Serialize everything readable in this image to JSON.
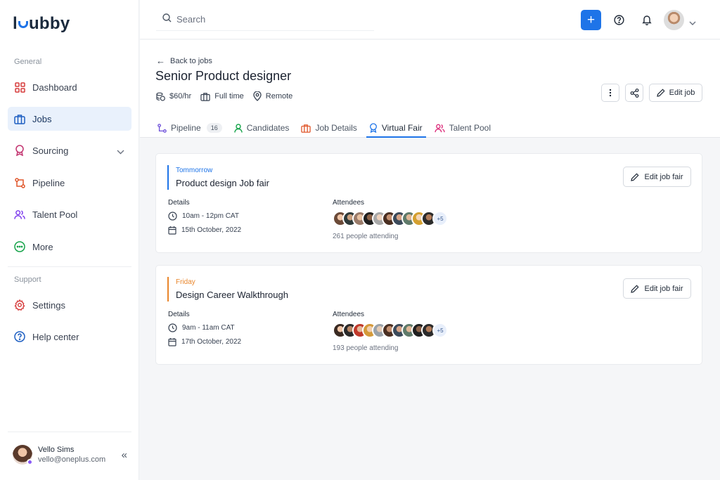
{
  "app": {
    "logo_text_pre": "l",
    "logo_text_post": "ubby"
  },
  "sidebar": {
    "general_label": "General",
    "support_label": "Support",
    "items": [
      {
        "label": "Dashboard",
        "icon": "dashboard-icon"
      },
      {
        "label": "Jobs",
        "icon": "briefcase-icon",
        "active": true
      },
      {
        "label": "Sourcing",
        "icon": "award-icon"
      },
      {
        "label": "Pipeline",
        "icon": "pipeline-icon"
      },
      {
        "label": "Talent Pool",
        "icon": "users-icon"
      },
      {
        "label": "More",
        "icon": "more-icon"
      }
    ],
    "support_items": [
      {
        "label": "Settings",
        "icon": "gear-icon"
      },
      {
        "label": "Help center",
        "icon": "help-icon"
      }
    ],
    "user": {
      "name": "Vello Sims",
      "email": "vello@oneplus.com"
    },
    "collapse_label": "«"
  },
  "topbar": {
    "search_placeholder": "Search",
    "plus_label": "+"
  },
  "job": {
    "back_label": "Back to jobs",
    "title": "Senior Product designer",
    "rate": "$60/hr",
    "type": "Full time",
    "location": "Remote",
    "edit_label": "Edit job"
  },
  "tabs": [
    {
      "label": "Pipeline",
      "badge": "16"
    },
    {
      "label": "Candidates"
    },
    {
      "label": "Job Details"
    },
    {
      "label": "Virtual Fair",
      "active": true
    },
    {
      "label": "Talent Pool"
    }
  ],
  "fairs": [
    {
      "when": "Tommorrow",
      "when_color": "#1e74e8",
      "title": "Product design Job fair",
      "details_label": "Details",
      "time": "10am - 12pm CAT",
      "date": "15th October, 2022",
      "attendees_label": "Attendees",
      "more": "+5",
      "attending": "261 people attending",
      "edit_label": "Edit job fair"
    },
    {
      "when": "Friday",
      "when_color": "#e9862b",
      "title": "Design Career Walkthrough",
      "details_label": "Details",
      "time": "9am - 11am CAT",
      "date": "17th October, 2022",
      "attendees_label": "Attendees",
      "more": "+5",
      "attending": "193 people attending",
      "edit_label": "Edit job fair"
    }
  ]
}
